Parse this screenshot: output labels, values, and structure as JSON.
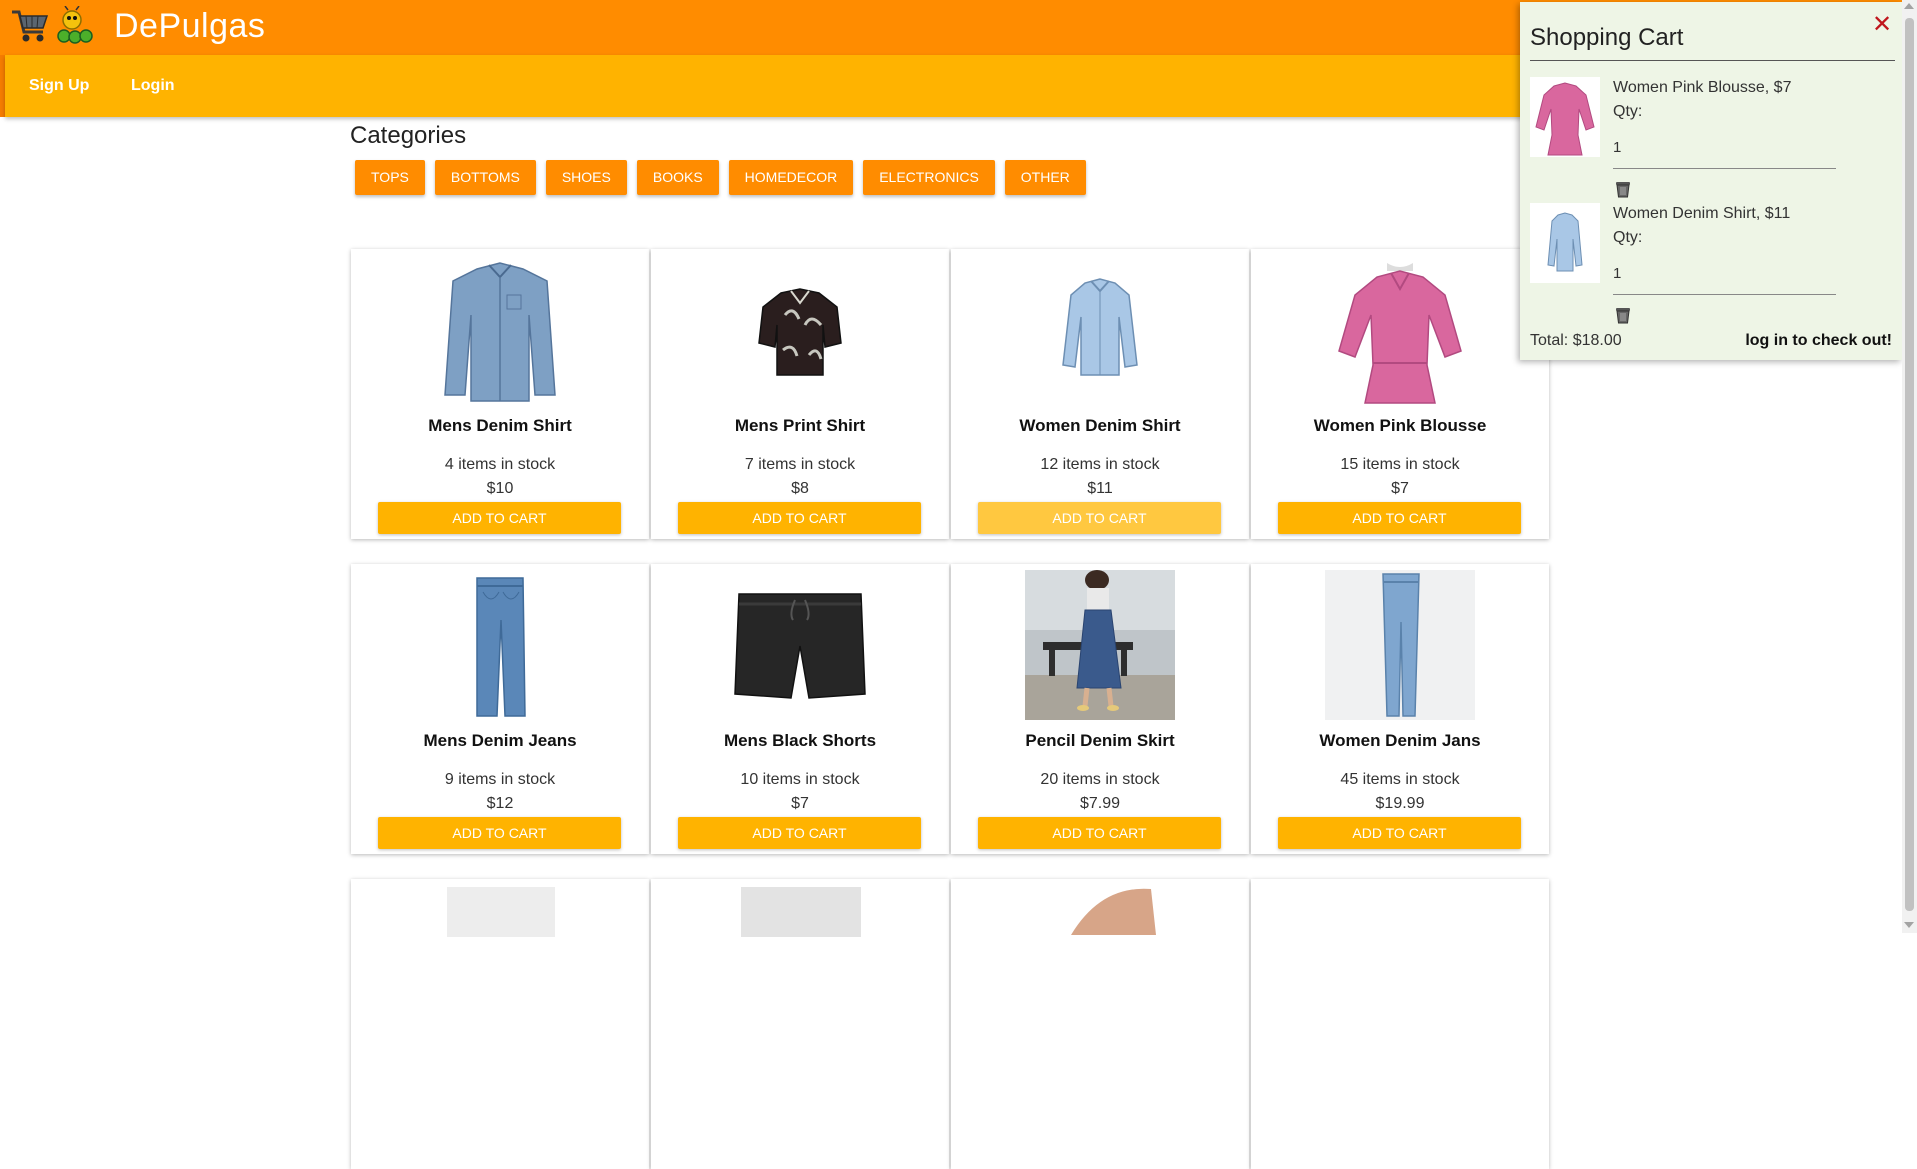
{
  "app": {
    "brand": "DePulgas",
    "icons": [
      "shopping-cart-icon",
      "caterpillar-logo-icon"
    ],
    "colors": {
      "header": "#ff8c00",
      "navbar": "#ffb300",
      "accent": "#ffb300",
      "cart_bg": "#eef5e6",
      "close": "#c0161d"
    }
  },
  "nav": {
    "signup": "Sign Up",
    "login": "Login"
  },
  "categories": {
    "title": "Categories",
    "items": [
      "TOPS",
      "BOTTOMS",
      "SHOES",
      "BOOKS",
      "HOMEDECOR",
      "ELECTRONICS",
      "OTHER"
    ]
  },
  "products": [
    {
      "name": "Mens Denim Shirt",
      "stock": "4 items in stock",
      "price": "$10",
      "button": "ADD TO CART",
      "image": "blue-denim-shirt"
    },
    {
      "name": "Mens Print Shirt",
      "stock": "7 items in stock",
      "price": "$8",
      "button": "ADD TO CART",
      "image": "print-shirt"
    },
    {
      "name": "Women Denim Shirt",
      "stock": "12 items in stock",
      "price": "$11",
      "button": "ADD TO CART",
      "image": "light-denim-shirt"
    },
    {
      "name": "Women Pink Blousse",
      "stock": "15 items in stock",
      "price": "$7",
      "button": "ADD TO CART",
      "image": "pink-blouse"
    },
    {
      "name": "Mens Denim Jeans",
      "stock": "9 items in stock",
      "price": "$12",
      "button": "ADD TO CART",
      "image": "jeans"
    },
    {
      "name": "Mens Black Shorts",
      "stock": "10 items in stock",
      "price": "$7",
      "button": "ADD TO CART",
      "image": "black-shorts"
    },
    {
      "name": "Pencil Denim Skirt",
      "stock": "20 items in stock",
      "price": "$7.99",
      "button": "ADD TO CART",
      "image": "denim-skirt-photo"
    },
    {
      "name": "Women Denim Jans",
      "stock": "45 items in stock",
      "price": "$19.99",
      "button": "ADD TO CART",
      "image": "skinny-jeans"
    }
  ],
  "cart": {
    "title": "Shopping Cart",
    "qty_label": "Qty:",
    "items": [
      {
        "label": "Women Pink Blousse, $7",
        "qty": "1",
        "image": "pink-blouse"
      },
      {
        "label": "Women Denim Shirt, $11",
        "qty": "1",
        "image": "light-denim-shirt"
      }
    ],
    "total": "Total: $18.00",
    "checkout": "log in to check out!"
  }
}
